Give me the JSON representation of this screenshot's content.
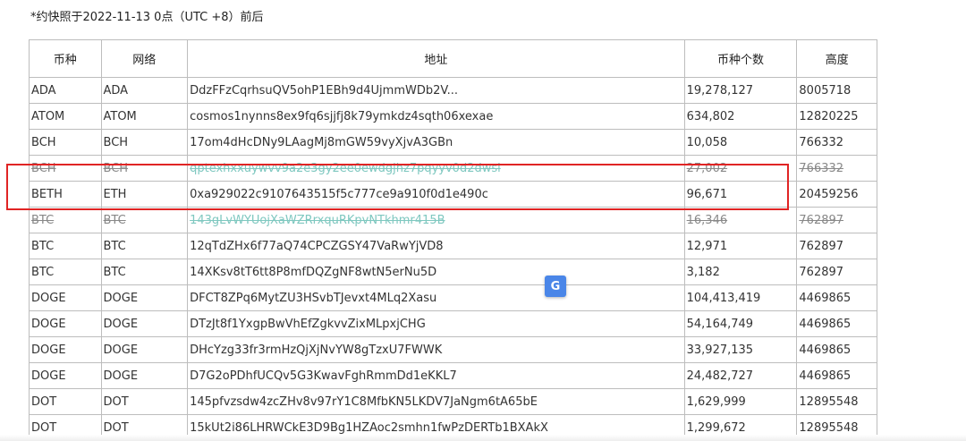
{
  "note": "*约快照于2022-11-13 0点（UTC +8）前后",
  "table": {
    "headers": [
      "币种",
      "网络",
      "地址",
      "币种个数",
      "高度"
    ],
    "rows": [
      {
        "coin": "ADA",
        "network": "ADA",
        "address": "DdzFFzCqrhsuQV5ohP1EBh9d4UjmmWDb2V...",
        "count": "19,278,127",
        "height": "8005718",
        "struck": false
      },
      {
        "coin": "ATOM",
        "network": "ATOM",
        "address": "cosmos1nynns8ex9fq6sjjfj8k79ymkdz4sqth06xexae",
        "count": "634,802",
        "height": "12820225",
        "struck": false
      },
      {
        "coin": "BCH",
        "network": "BCH",
        "address": "17om4dHcDNy9LAagMj8mGW59vyXjvA3GBn",
        "count": "10,058",
        "height": "766332",
        "struck": false
      },
      {
        "coin": "BCH",
        "network": "BCH",
        "address": "qptexhxxuywvv9a2e3gy2ee0ewdgjhz7pqyyv0d2dwsl",
        "count": "27,002",
        "height": "766332",
        "struck": true
      },
      {
        "coin": "BETH",
        "network": "ETH",
        "address": "0xa929022c9107643515f5c777ce9a910f0d1e490c",
        "count": "96,671",
        "height": "20459256",
        "struck": false
      },
      {
        "coin": "BTC",
        "network": "BTC",
        "address": "143gLvWYUojXaWZRrxquRKpvNTkhmr415B",
        "count": "16,346",
        "height": "762897",
        "struck": true
      },
      {
        "coin": "BTC",
        "network": "BTC",
        "address": "12qTdZHx6f77aQ74CPCZGSY47VaRwYjVD8",
        "count": "12,971",
        "height": "762897",
        "struck": false
      },
      {
        "coin": "BTC",
        "network": "BTC",
        "address": "14XKsv8tT6tt8P8mfDQZgNF8wtN5erNu5D",
        "count": "3,182",
        "height": "762897",
        "struck": false
      },
      {
        "coin": "DOGE",
        "network": "DOGE",
        "address": "DFCT8ZPq6MytZU3HSvbTJevxt4MLq2Xasu",
        "count": "104,413,419",
        "height": "4469865",
        "struck": false
      },
      {
        "coin": "DOGE",
        "network": "DOGE",
        "address": "DTzJt8f1YxgpBwVhEfZgkvvZixMLpxjCHG",
        "count": "54,164,749",
        "height": "4469865",
        "struck": false
      },
      {
        "coin": "DOGE",
        "network": "DOGE",
        "address": "DHcYzg33fr3rmHzQjXjNvYW8gTzxU7FWWK",
        "count": "33,927,135",
        "height": "4469865",
        "struck": false
      },
      {
        "coin": "DOGE",
        "network": "DOGE",
        "address": "D7G2oPDhfUCQv5G3KwavFghRmmDd1eKKL7",
        "count": "24,482,727",
        "height": "4469865",
        "struck": false
      },
      {
        "coin": "DOT",
        "network": "DOT",
        "address": "145pfvzsdw4zcZHv8v97rY1C8MfbKN5LKDV7JaNgm6tA65bE",
        "count": "1,629,999",
        "height": "12895548",
        "struck": false
      },
      {
        "coin": "DOT",
        "network": "DOT",
        "address": "15kUt2i86LHRWCkE3D9Bg1HZAoc2smhn1fwPzDERTb1BXAkX",
        "count": "1,299,672",
        "height": "12895548",
        "struck": false
      }
    ]
  },
  "translate_icon": {
    "name": "google-translate-icon",
    "glyph": "G",
    "color": "#4a86e8"
  },
  "colors": {
    "address_link": "#26a69a",
    "highlight": "#e02424",
    "border": "#bdbdbd"
  }
}
